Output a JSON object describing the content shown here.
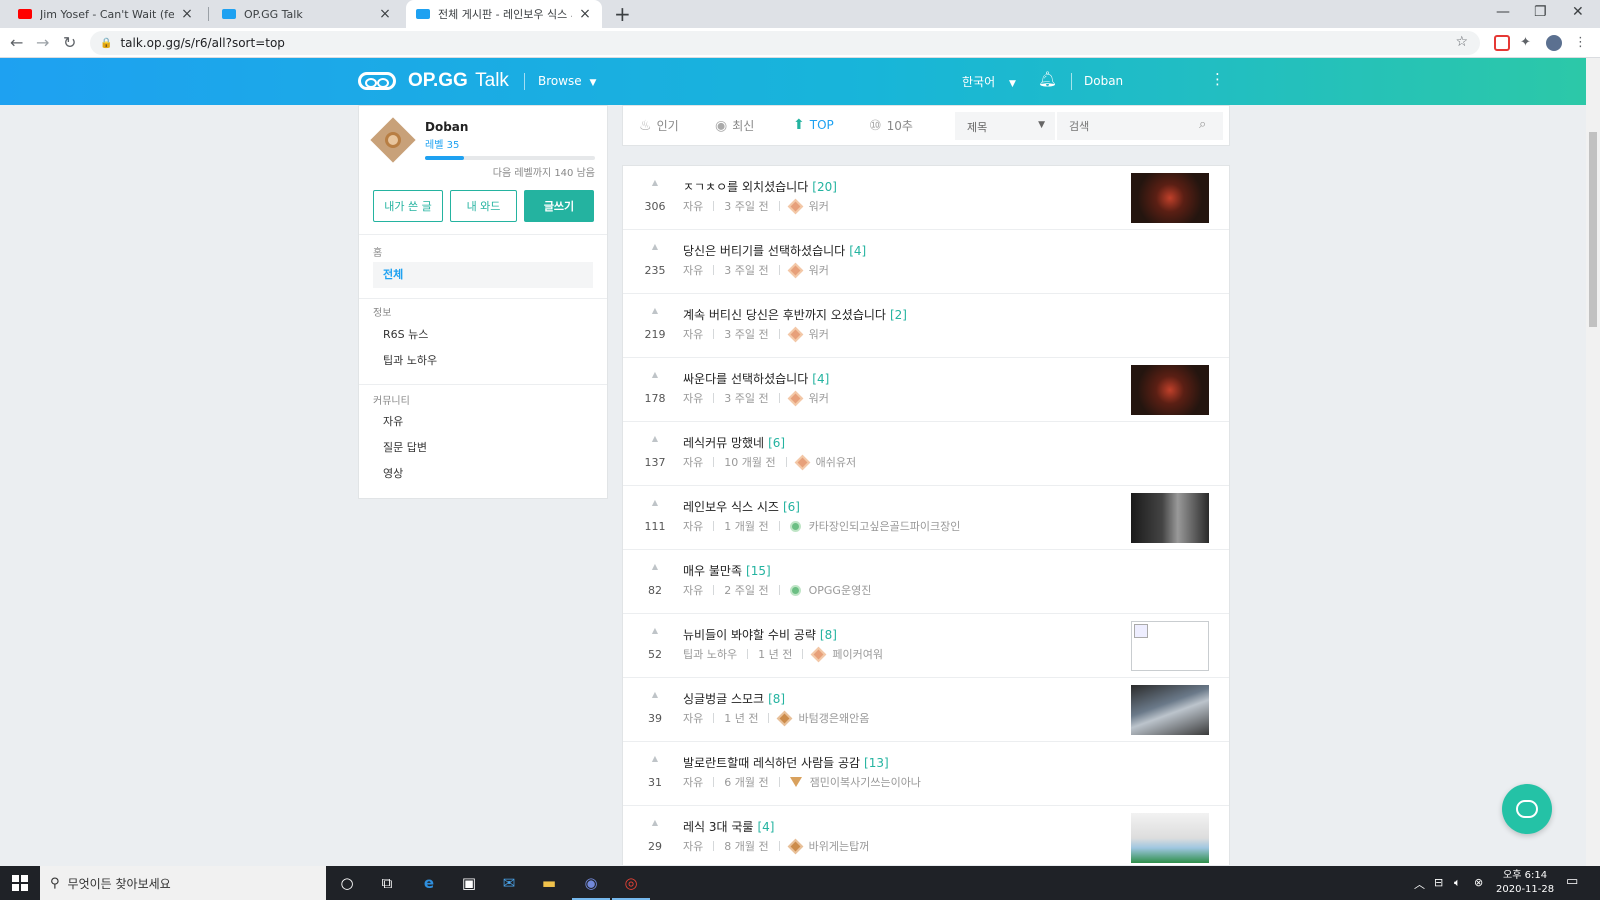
{
  "browser": {
    "tabs": [
      {
        "title": "Jim Yosef - Can't Wait (feat. An",
        "icon": "youtube-icon",
        "color": "#ff0000"
      },
      {
        "title": "OP.GG Talk",
        "icon": "opgg-icon",
        "color": "#1ea1f1"
      },
      {
        "title": "전체 게시판 - 레인보우 식스 시즈",
        "icon": "opgg-icon",
        "color": "#1ea1f1"
      }
    ],
    "url": "talk.op.gg/s/r6/all?sort=top"
  },
  "header": {
    "logo": "OP.GG",
    "logo_sub": "Talk",
    "browse_label": "Browse",
    "language": "한국어",
    "username": "Doban"
  },
  "profile": {
    "name": "Doban",
    "level": "레벨 35",
    "progress": 0.23,
    "next_level_text": "다음 레벨까지 140 남음",
    "buttons": {
      "my_posts": "내가 쓴 글",
      "my_comments": "내 와드",
      "write": "글쓰기"
    }
  },
  "sidebar": {
    "sections": [
      {
        "title": "홈",
        "items": [
          "전체"
        ]
      },
      {
        "title": "정보",
        "items": [
          "R6S 뉴스",
          "팁과 노하우"
        ]
      },
      {
        "title": "커뮤니티",
        "items": [
          "자유",
          "질문 답변",
          "영상"
        ]
      }
    ]
  },
  "sortbar": {
    "options": [
      {
        "label": "인기",
        "icon": "flame-icon"
      },
      {
        "label": "최신",
        "icon": "clock-icon"
      },
      {
        "label": "TOP",
        "icon": "up-arrow-icon",
        "active": true
      },
      {
        "label": "10추",
        "icon": "ten-icon"
      }
    ],
    "filter_selected": "제목",
    "search_placeholder": "검색"
  },
  "posts": [
    {
      "votes": "306",
      "title": "ㅈㄱㅊㅇ를 외치셨습니다",
      "comments": "[20]",
      "category": "자유",
      "time": "3 주일 전",
      "author": "워커",
      "thumb": "dark"
    },
    {
      "votes": "235",
      "title": "당신은 버티기를 선택하셨습니다",
      "comments": "[4]",
      "category": "자유",
      "time": "3 주일 전",
      "author": "워커",
      "thumb": ""
    },
    {
      "votes": "219",
      "title": "계속 버티신 당신은 후반까지 오셨습니다",
      "comments": "[2]",
      "category": "자유",
      "time": "3 주일 전",
      "author": "워커",
      "thumb": ""
    },
    {
      "votes": "178",
      "title": "싸운다를 선택하셨습니다",
      "comments": "[4]",
      "category": "자유",
      "time": "3 주일 전",
      "author": "워커",
      "thumb": "dark"
    },
    {
      "votes": "137",
      "title": "레식커뮤 망했네",
      "comments": "[6]",
      "category": "자유",
      "time": "10 개월 전",
      "author": "애쉬유저",
      "thumb": ""
    },
    {
      "votes": "111",
      "title": "레인보우 식스 시즈",
      "comments": "[6]",
      "category": "자유",
      "time": "1 개월 전",
      "author": "카타장인되고싶은골드파이크장인",
      "thumb": "r6"
    },
    {
      "votes": "82",
      "title": "매우 불만족",
      "comments": "[15]",
      "category": "자유",
      "time": "2 주일 전",
      "author": "OPGG운영진",
      "thumb": ""
    },
    {
      "votes": "52",
      "title": "뉴비들이 봐야할 수비 공략",
      "comments": "[8]",
      "category": "팁과 노하우",
      "time": "1 년 전",
      "author": "페이커여워",
      "thumb": "broken"
    },
    {
      "votes": "39",
      "title": "싱글벙글 스모크",
      "comments": "[8]",
      "category": "자유",
      "time": "1 년 전",
      "author": "바텀갱은왜안옴",
      "thumb": "street"
    },
    {
      "votes": "31",
      "title": "발로란트할때 레식하던 사람들 공감",
      "comments": "[13]",
      "category": "자유",
      "time": "6 개월 전",
      "author": "잼민이복사기쓰는이아나",
      "thumb": ""
    },
    {
      "votes": "29",
      "title": "레식 3대 국룰",
      "comments": "[4]",
      "category": "자유",
      "time": "8 개월 전",
      "author": "바위게는탑꺼",
      "thumb": "sketch"
    }
  ],
  "taskbar": {
    "search_placeholder": "무엇이든 찾아보세요",
    "time": "오후 6:14",
    "date": "2020-11-28"
  },
  "colors": {
    "accent": "#1ea1f1",
    "teal": "#24b3a0",
    "header_end": "#2cc8a8"
  }
}
